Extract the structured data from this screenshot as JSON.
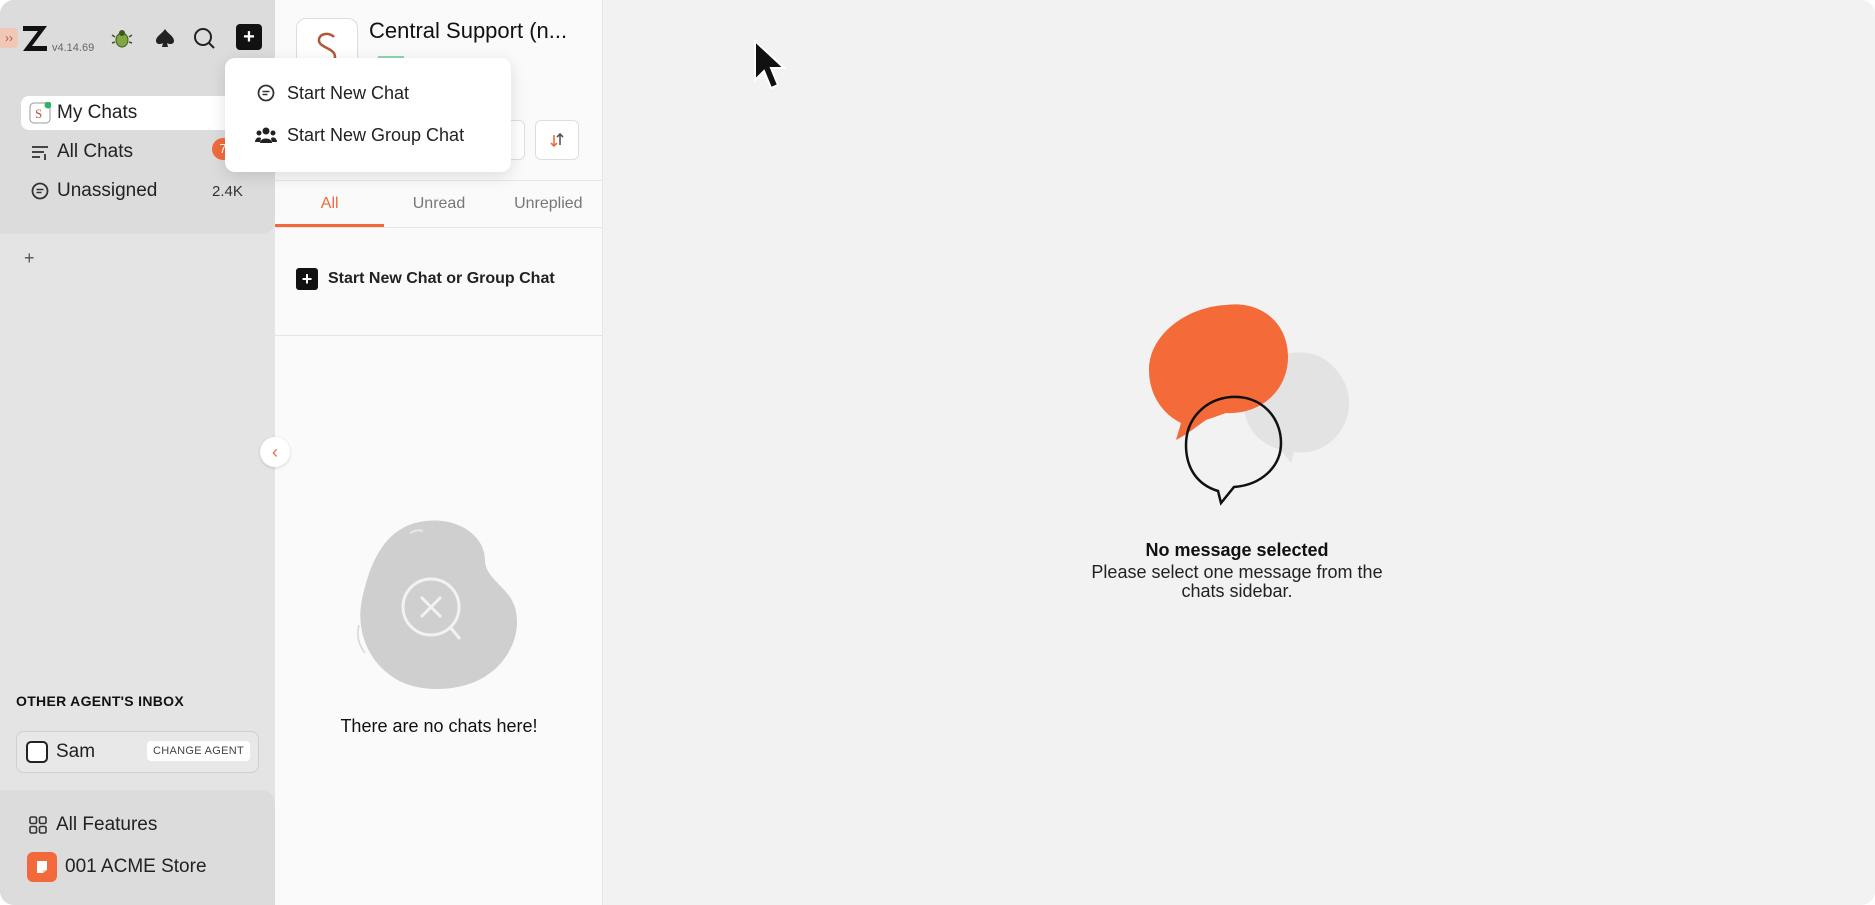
{
  "app": {
    "version": "v4.14.69"
  },
  "sidebar": {
    "items": [
      {
        "label": "My Chats",
        "icon": "inbox-avatar-icon"
      },
      {
        "label": "All Chats",
        "icon": "filter-lines-icon",
        "badge": "7"
      },
      {
        "label": "Unassigned",
        "icon": "chat-bubble-icon",
        "count": "2.4K"
      }
    ],
    "add_label": "+",
    "other_inbox_title": "OTHER AGENT'S INBOX",
    "agent_name": "Sam",
    "change_agent_label": "CHANGE AGENT",
    "all_features_label": "All Features",
    "store_label": "001 ACME Store"
  },
  "dropdown": {
    "items": [
      {
        "label": "Start New Chat",
        "icon": "chat-bubble-icon"
      },
      {
        "label": "Start New Group Chat",
        "icon": "group-icon"
      }
    ]
  },
  "panel": {
    "inbox_title": "Central Support (n...",
    "tabs": [
      {
        "label": "All",
        "active": true
      },
      {
        "label": "Unread",
        "active": false
      },
      {
        "label": "Unreplied",
        "active": false
      }
    ],
    "start_label": "Start New Chat or Group Chat",
    "empty_text": "There are no chats here!"
  },
  "main": {
    "title": "No message selected",
    "subtitle_line1": "Please select one message from the",
    "subtitle_line2": "chats sidebar."
  },
  "colors": {
    "accent": "#f26a3c",
    "sidebar_bg": "#e4e4e4",
    "main_bg": "#f2f2f2"
  }
}
